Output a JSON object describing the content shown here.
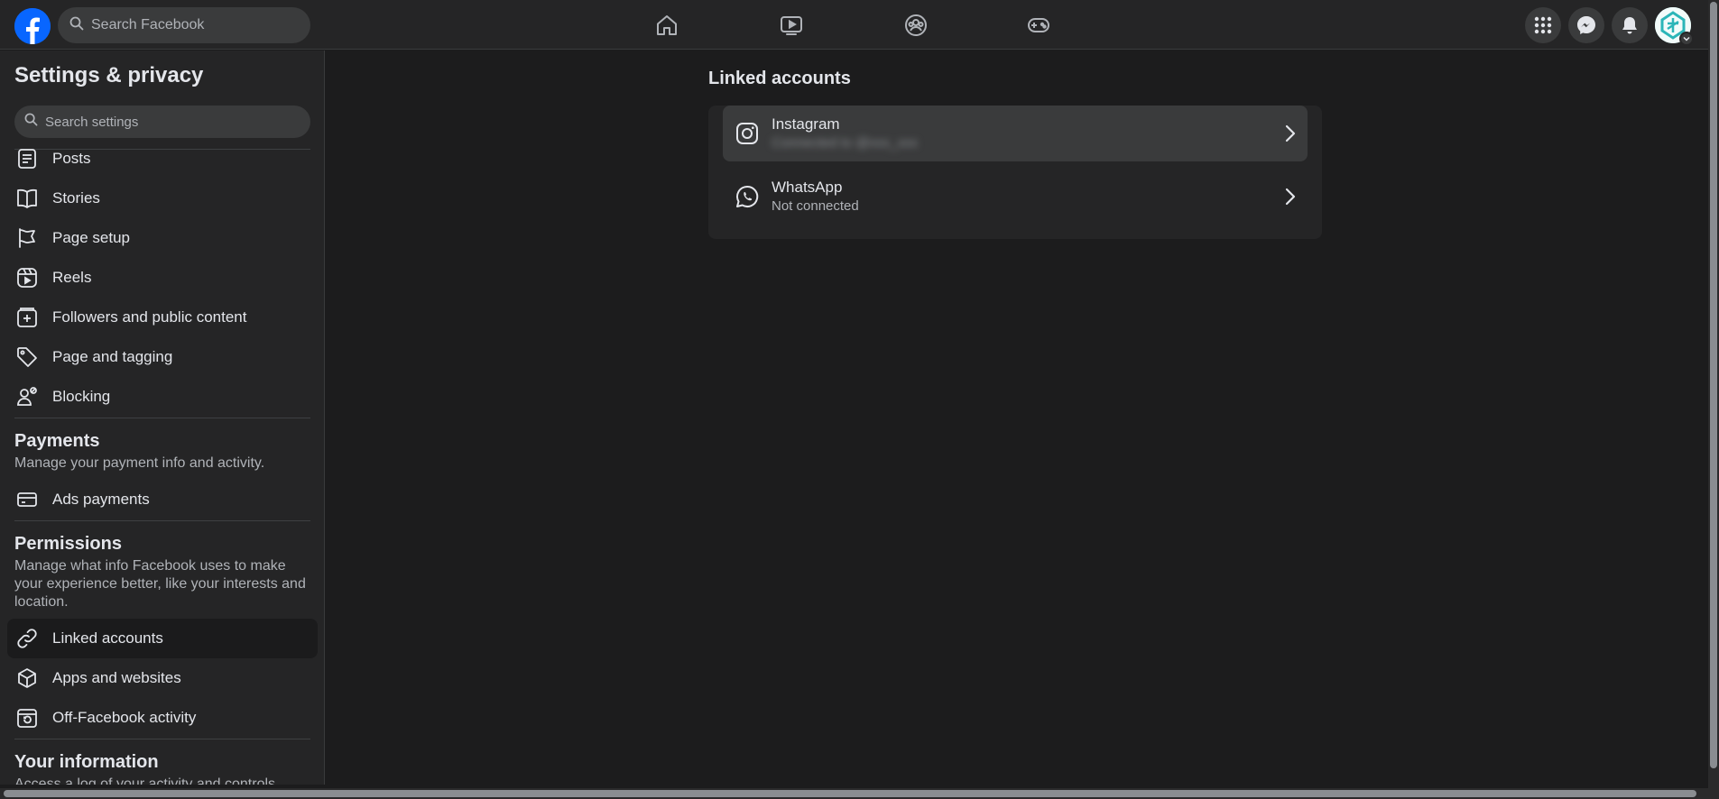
{
  "topbar": {
    "search_placeholder": "Search Facebook",
    "nav": [
      "home-icon",
      "watch-icon",
      "groups-icon",
      "gaming-icon"
    ],
    "right": [
      "menu-grid-icon",
      "messenger-icon",
      "notifications-icon"
    ]
  },
  "sidebar": {
    "title": "Settings & privacy",
    "search_placeholder": "Search settings",
    "items_top": [
      {
        "label": "Posts",
        "icon": "posts-icon"
      },
      {
        "label": "Stories",
        "icon": "stories-icon"
      },
      {
        "label": "Page setup",
        "icon": "flag-icon"
      },
      {
        "label": "Reels",
        "icon": "reels-icon"
      },
      {
        "label": "Followers and public content",
        "icon": "followers-icon"
      },
      {
        "label": "Page and tagging",
        "icon": "tag-icon"
      },
      {
        "label": "Blocking",
        "icon": "block-user-icon"
      }
    ],
    "payments": {
      "title": "Payments",
      "desc": "Manage your payment info and activity.",
      "items": [
        {
          "label": "Ads payments",
          "icon": "card-icon"
        }
      ]
    },
    "permissions": {
      "title": "Permissions",
      "desc": "Manage what info Facebook uses to make your experience better, like your interests and location.",
      "items": [
        {
          "label": "Linked accounts",
          "icon": "link-icon",
          "active": true
        },
        {
          "label": "Apps and websites",
          "icon": "cube-icon"
        },
        {
          "label": "Off-Facebook activity",
          "icon": "history-icon"
        }
      ]
    },
    "your_information": {
      "title": "Your information",
      "desc": "Access a log of your activity and controls"
    }
  },
  "main": {
    "title": "Linked accounts",
    "accounts": [
      {
        "name": "Instagram",
        "status": "Connected to @xxx_xxx",
        "icon": "instagram-icon"
      },
      {
        "name": "WhatsApp",
        "status": "Not connected",
        "icon": "whatsapp-icon"
      }
    ]
  },
  "colors": {
    "accent": "#0866ff",
    "background": "#1c1c1d",
    "surface": "#252526"
  }
}
